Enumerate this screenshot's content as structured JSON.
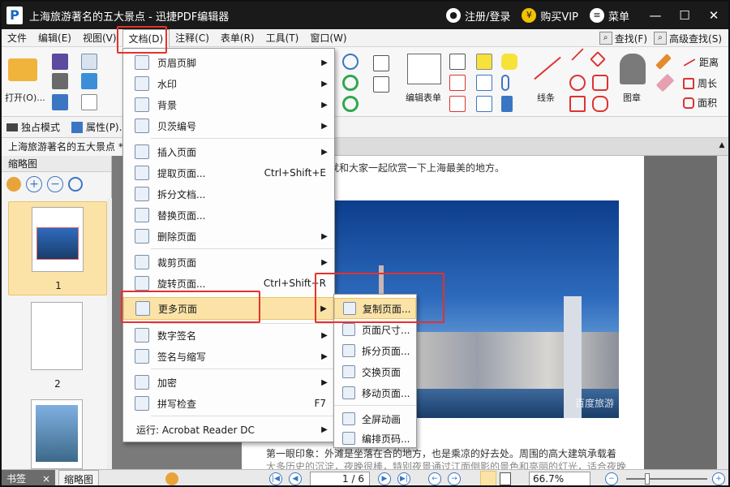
{
  "window": {
    "title": "上海旅游著名的五大景点 - 迅捷PDF编辑器",
    "logo": "P"
  },
  "titlebar": {
    "login": "注册/登录",
    "vip": "购买VIP",
    "menu": "菜单",
    "minimize": "—",
    "maximize": "☐",
    "close": "✕"
  },
  "menubar": {
    "items": [
      "文件",
      "编辑(E)",
      "视图(V)",
      "文档(D)",
      "注释(C)",
      "表单(R)",
      "工具(T)",
      "窗口(W)"
    ],
    "find": "查找(F)",
    "advanced_find": "高级查找(S)"
  },
  "ribbon": {
    "open": "打开(O)...",
    "edit_form": "编辑表单",
    "lines": "线条",
    "stamp": "图章",
    "distance": "距离",
    "perimeter": "周长",
    "area": "面积"
  },
  "subbar": {
    "exclusive_mode": "独占模式",
    "properties": "属性(P)..."
  },
  "doc_tab": {
    "label": "上海旅游著名的五大景点 *"
  },
  "sidebar": {
    "title": "缩略图",
    "thumbs": [
      "1",
      "2"
    ]
  },
  "document": {
    "top_text": "就和大家一起欣赏一下上海最美的地方。",
    "bottom_text": "第一眼印象：外滩是坐落在合的地方，也是乘凉的好去处。周围的高大建筑承载着",
    "bottom_text2": "大多历史的沉淀，夜晚很棒，特别夜景通过江面倒影的景色和亮丽的灯光，适合夜晚",
    "watermark": "百度旅游"
  },
  "dropdown": {
    "items": [
      {
        "label": "页眉页脚",
        "shortcut": "",
        "submenu": true,
        "icon": "header-footer-icon"
      },
      {
        "label": "水印",
        "shortcut": "",
        "submenu": true,
        "icon": "watermark-icon"
      },
      {
        "label": "背景",
        "shortcut": "",
        "submenu": true,
        "icon": "background-icon"
      },
      {
        "label": "贝茨编号",
        "shortcut": "",
        "submenu": true,
        "icon": "bates-number-icon"
      },
      {
        "label": "插入页面",
        "shortcut": "",
        "submenu": true,
        "icon": "insert-page-icon"
      },
      {
        "label": "提取页面...",
        "shortcut": "Ctrl+Shift+E",
        "submenu": false,
        "icon": "extract-page-icon"
      },
      {
        "label": "拆分文档...",
        "shortcut": "",
        "submenu": false,
        "icon": "split-document-icon"
      },
      {
        "label": "替换页面...",
        "shortcut": "",
        "submenu": false,
        "icon": "replace-page-icon"
      },
      {
        "label": "删除页面",
        "shortcut": "",
        "submenu": true,
        "icon": "delete-page-icon"
      },
      {
        "label": "裁剪页面",
        "shortcut": "",
        "submenu": true,
        "icon": "crop-page-icon"
      },
      {
        "label": "旋转页面...",
        "shortcut": "Ctrl+Shift+R",
        "submenu": false,
        "icon": "rotate-page-icon"
      },
      {
        "label": "更多页面",
        "shortcut": "",
        "submenu": true,
        "icon": "more-pages-icon"
      },
      {
        "label": "数字签名",
        "shortcut": "",
        "submenu": true,
        "icon": "digital-signature-icon"
      },
      {
        "label": "签名与缩写",
        "shortcut": "",
        "submenu": true,
        "icon": "signature-initials-icon"
      },
      {
        "label": "加密",
        "shortcut": "",
        "submenu": true,
        "icon": "encrypt-icon"
      },
      {
        "label": "拼写检查",
        "shortcut": "F7",
        "submenu": false,
        "icon": "spell-check-icon"
      },
      {
        "label": "运行:  Acrobat Reader DC",
        "shortcut": "",
        "submenu": true,
        "icon": "acrobat-icon"
      }
    ]
  },
  "submenu": {
    "items": [
      {
        "label": "复制页面...",
        "icon": "copy-page-icon"
      },
      {
        "label": "页面尺寸...",
        "icon": "page-size-icon"
      },
      {
        "label": "拆分页面...",
        "icon": "split-page-icon"
      },
      {
        "label": "交换页面",
        "icon": "swap-page-icon"
      },
      {
        "label": "移动页面...",
        "icon": "move-page-icon"
      },
      {
        "label": "全屏动画",
        "icon": "fullscreen-animation-icon"
      },
      {
        "label": "编排页码...",
        "icon": "arrange-page-number-icon"
      }
    ]
  },
  "bottombar": {
    "bookmark_tab": "书签",
    "bookmark_close": "×",
    "thumb_tab": "缩略图",
    "page_input": "1 / 6",
    "zoom": "66.7%"
  },
  "colors": {
    "accent": "#1769c7",
    "highlight": "#fbe3a8",
    "callout": "#e5312c",
    "titlebar": "#1a1a1a"
  }
}
